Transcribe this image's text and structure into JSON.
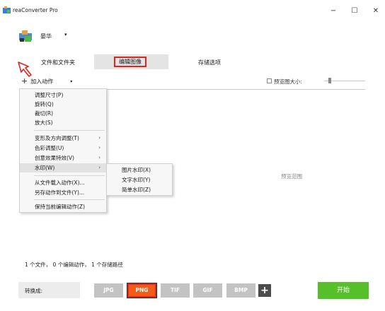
{
  "window": {
    "title": "reaConverter Pro",
    "controls": {
      "minimize": "−",
      "maximize": "☐",
      "close": "✕"
    }
  },
  "user": {
    "name": "晏华",
    "caret": "▾"
  },
  "tabs": [
    {
      "label": "文件和文件夹"
    },
    {
      "label": "编辑图像"
    },
    {
      "label": "存储选项"
    }
  ],
  "toolbar": {
    "add_action_icon": "+",
    "add_action_label": "加入动作",
    "add_action_caret": "▾",
    "preview_size_label": "预览图大小:"
  },
  "preview": {
    "label": "预览范围"
  },
  "menu": {
    "items": [
      {
        "label": "调整尺寸(P)"
      },
      {
        "label": "旋转(Q)"
      },
      {
        "label": "裁切(R)"
      },
      {
        "label": "放大(S)"
      },
      {
        "label": "变形及方向调整(T)",
        "arrow": "›"
      },
      {
        "label": "色彩调整(U)",
        "arrow": "›"
      },
      {
        "label": "创意效果特效(V)",
        "arrow": "›"
      },
      {
        "label": "水印(W)",
        "arrow": "›"
      },
      {
        "label": "从文件载入动作(X)..."
      },
      {
        "label": "另存动作到文件(Y)..."
      },
      {
        "label": "保持当前编辑动作(Z)"
      }
    ],
    "submenu": [
      {
        "label": "图片水印(X)"
      },
      {
        "label": "文字水印(Y)"
      },
      {
        "label": "简单水印(Z)"
      }
    ]
  },
  "status": "1 个文件， 0 个编辑动作， 1 个存储路径",
  "bottom": {
    "convert_label": "转换成:",
    "formats": [
      "JPG",
      "PNG",
      "TIF",
      "GIF",
      "BMP"
    ],
    "selected_format": "PNG",
    "add_format": "+",
    "start_label": "开始"
  },
  "colors": {
    "accent_orange": "#f25b18",
    "highlight_red": "#e0261c",
    "start_green": "#56c02a",
    "format_gray": "#c3c3c3"
  }
}
